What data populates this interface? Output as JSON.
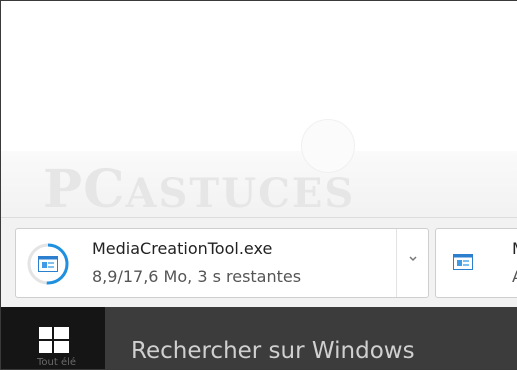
{
  "download_shelf": {
    "items": [
      {
        "file_name": "MediaCreationTool.exe",
        "status": "8,9/17,6 Mo, 3 s restantes",
        "progress": 0.51,
        "menu_icon": "chevron-down-icon"
      },
      {
        "file_name": "M",
        "status": "A"
      }
    ]
  },
  "taskbar": {
    "start_icon": "windows-logo-icon",
    "start_caption": "Tout élé",
    "search_placeholder": "Rechercher sur Windows"
  },
  "watermark": {
    "text_large": "PC",
    "text_small": "ASTUCES"
  },
  "colors": {
    "progress_ring": "#1e90e0",
    "taskbar": "#1f1f1f",
    "search_box": "#3c3c3c"
  }
}
